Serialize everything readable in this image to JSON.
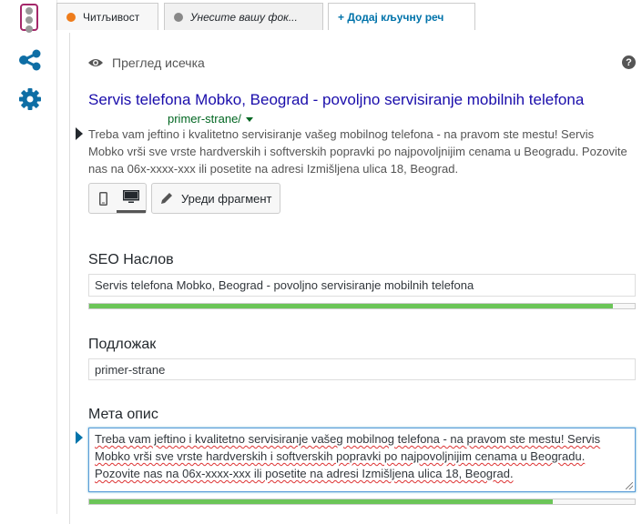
{
  "colors": {
    "readability_bullet": "#ee7c1b",
    "focus_bullet": "#888888",
    "accent": "#0073aa",
    "title_link": "#1a0dab",
    "url_green": "#006621",
    "progress_green": "#6bc558"
  },
  "sidebar": {
    "items": [
      {
        "icon": "traffic-light-icon"
      },
      {
        "icon": "share-icon"
      },
      {
        "icon": "gear-icon"
      }
    ]
  },
  "tabs": {
    "readability": "Читљивост",
    "focus_keyword_placeholder": "Унесите вашу фок...",
    "add_keyword": "+ Додај кључну реч"
  },
  "preview": {
    "heading": "Преглед исечка",
    "help": "?",
    "title": "Servis telefona Mobko, Beograd - povoljno servisiranje mobilnih telefona",
    "url": "primer-strane/",
    "description": "Treba vam jeftino i kvalitetno servisiranje vašeg mobilnog telefona - na pravom ste mestu! Servis Mobko vrši sve vrste hardverskih i softverskih popravki po najpovoljnijim cenama u Beogradu. Pozovite nas na 06x-xxxx-xxx ili posetite na adresi Izmišljena ulica 18, Beograd.",
    "edit_snippet": "Уреди фрагмент"
  },
  "seo_title": {
    "label": "SEO Наслов",
    "value": "Servis telefona Mobko, Beograd - povoljno servisiranje mobilnih telefona",
    "progress": 96
  },
  "slug": {
    "label": "Подложак",
    "value": "primer-strane"
  },
  "meta_description": {
    "label": "Мета опис",
    "value": "Treba vam jeftino i kvalitetno servisiranje vašeg mobilnog telefona - na pravom ste mestu! Servis Mobko vrši sve vrste hardverskih i softverskih popravki po najpovoljnijim cenama u Beogradu. Pozovite nas na 06x-xxxx-xxx ili posetite na adresi Izmišljena ulica 18, Beograd.",
    "progress": 85
  }
}
